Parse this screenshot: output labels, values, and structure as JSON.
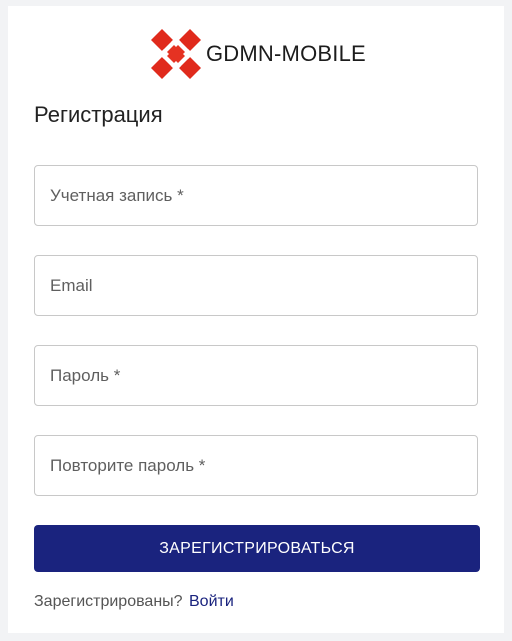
{
  "brand": {
    "name": "GDMN-MOBILE",
    "logo_colors": [
      "#e02a1c",
      "#f04a1c"
    ]
  },
  "form": {
    "title": "Регистрация",
    "fields": [
      {
        "label": "Учетная запись *",
        "value": ""
      },
      {
        "label": "Email",
        "value": ""
      },
      {
        "label": "Пароль *",
        "value": ""
      },
      {
        "label": "Повторите пароль *",
        "value": ""
      }
    ],
    "submit_label": "ЗАРЕГИСТРИРОВАТЬСЯ",
    "submit_color": "#1a237e"
  },
  "footer": {
    "prompt": "Зарегистрированы?",
    "link_label": "Войти"
  }
}
